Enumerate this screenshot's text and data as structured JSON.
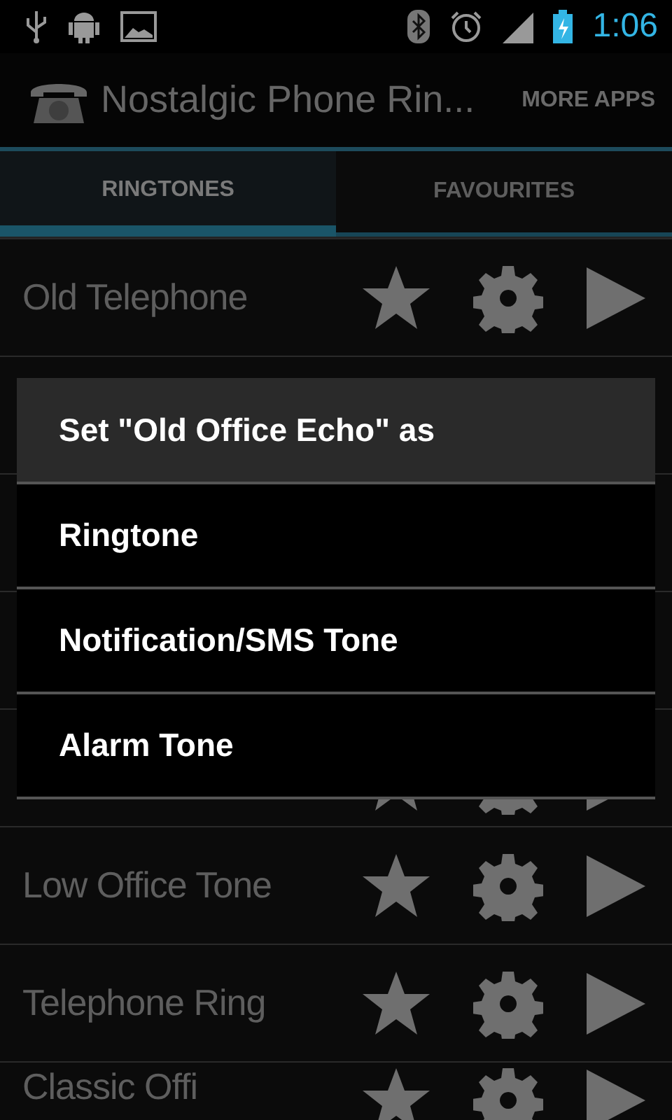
{
  "status_bar": {
    "time": "1:06"
  },
  "action_bar": {
    "title": "Nostalgic Phone Rin...",
    "action": "MORE APPS"
  },
  "tabs": [
    {
      "label": "RINGTONES",
      "selected": true
    },
    {
      "label": "FAVOURITES",
      "selected": false
    }
  ],
  "rows": [
    {
      "kind": "visible",
      "title": "Old Telephone"
    },
    {
      "kind": "covered"
    },
    {
      "kind": "covered"
    },
    {
      "kind": "covered"
    },
    {
      "kind": "partly_covered"
    },
    {
      "kind": "visible",
      "title": "Low Office Tone"
    },
    {
      "kind": "visible",
      "title": "Telephone Ring"
    },
    {
      "kind": "cut",
      "title": "Classic Offi"
    }
  ],
  "dialog": {
    "title": "Set \"Old Office Echo\" as",
    "options": [
      "Ringtone",
      "Notification/SMS Tone",
      "Alarm Tone"
    ]
  }
}
